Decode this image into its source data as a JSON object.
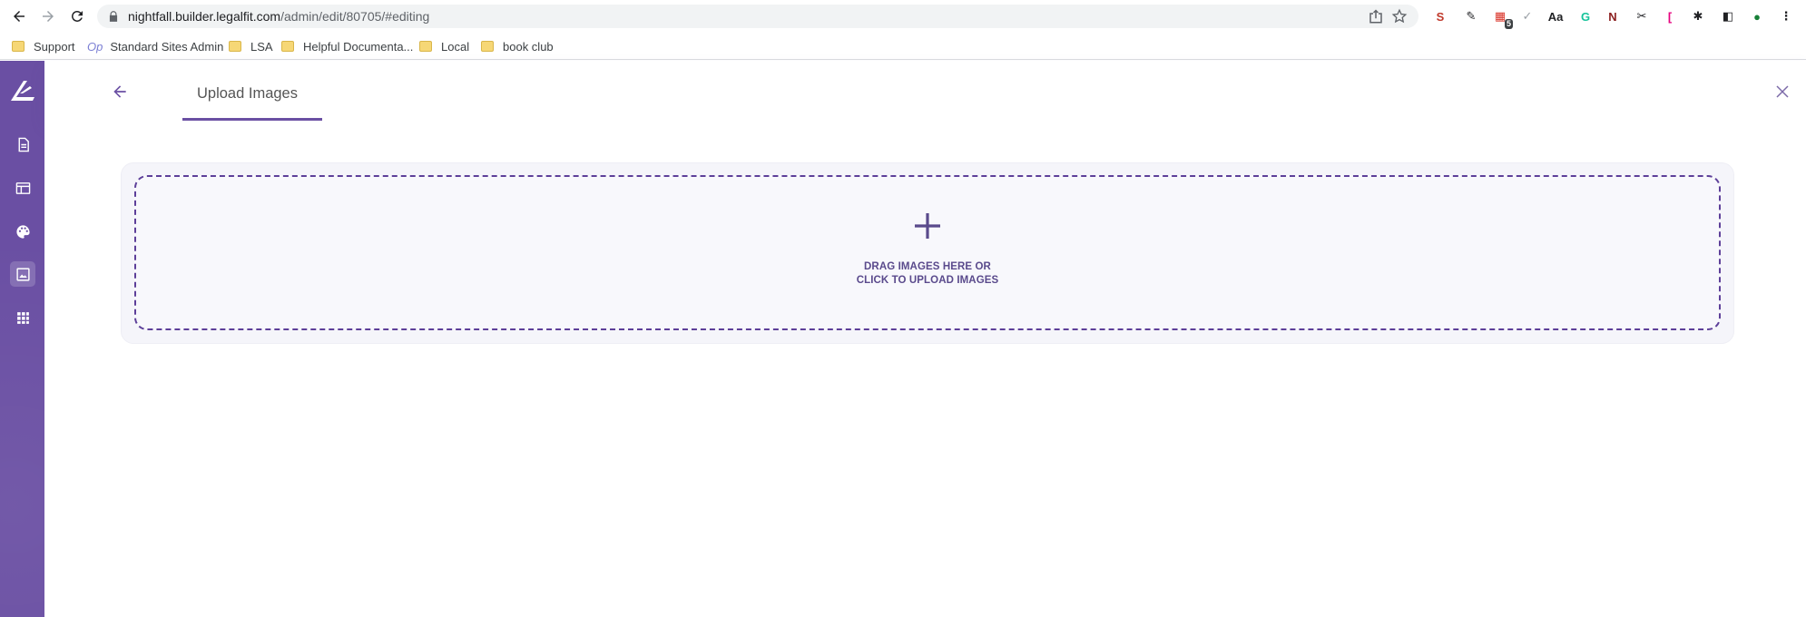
{
  "browser": {
    "url_host": "nightfall.builder.legalfit.com",
    "url_path": "/admin/edit/80705/#editing",
    "extensions": [
      {
        "name": "s-extension-icon",
        "glyph": "S",
        "color": "#c0392b"
      },
      {
        "name": "pen-extension-icon",
        "glyph": "✎",
        "color": "#202124"
      },
      {
        "name": "calendar-extension-icon",
        "glyph": "▦",
        "color": "#d93025",
        "badge": "5"
      },
      {
        "name": "check-extension-icon",
        "glyph": "✓",
        "color": "#9aa0a6"
      },
      {
        "name": "dictionary-extension-icon",
        "glyph": "Aa",
        "color": "#202124"
      },
      {
        "name": "grammarly-extension-icon",
        "glyph": "G",
        "color": "#15c39a"
      },
      {
        "name": "n-extension-icon",
        "glyph": "N",
        "color": "#8b1e1e"
      },
      {
        "name": "ghost-extension-icon",
        "glyph": "✂",
        "color": "#202124"
      },
      {
        "name": "bracket-extension-icon",
        "glyph": "[",
        "color": "#e6007e"
      },
      {
        "name": "puzzle-extension-icon",
        "glyph": "✱",
        "color": "#202124"
      },
      {
        "name": "side-panel-icon",
        "glyph": "◧",
        "color": "#202124"
      },
      {
        "name": "profile-avatar-icon",
        "glyph": "●",
        "color": "#188038"
      },
      {
        "name": "more-menu-icon",
        "glyph": "⋮",
        "color": "#202124"
      }
    ]
  },
  "bookmarks": [
    {
      "label": "Support",
      "type": "folder"
    },
    {
      "label": "Standard Sites Admin",
      "type": "op"
    },
    {
      "label": "LSA",
      "type": "folder"
    },
    {
      "label": "Helpful Documenta...",
      "type": "folder"
    },
    {
      "label": "Local",
      "type": "folder"
    },
    {
      "label": "book club",
      "type": "folder"
    }
  ],
  "sidebar": {
    "accent_color": "#6a4fa3",
    "items": [
      {
        "name": "pages",
        "icon": "document-icon"
      },
      {
        "name": "layout",
        "icon": "layout-icon"
      },
      {
        "name": "theme",
        "icon": "palette-icon"
      },
      {
        "name": "images",
        "icon": "image-icon",
        "active": true
      },
      {
        "name": "apps",
        "icon": "grid-icon"
      }
    ]
  },
  "header": {
    "tab_label": "Upload Images"
  },
  "dropzone": {
    "line1": "DRAG IMAGES HERE OR",
    "line2": "CLICK TO UPLOAD IMAGES"
  }
}
